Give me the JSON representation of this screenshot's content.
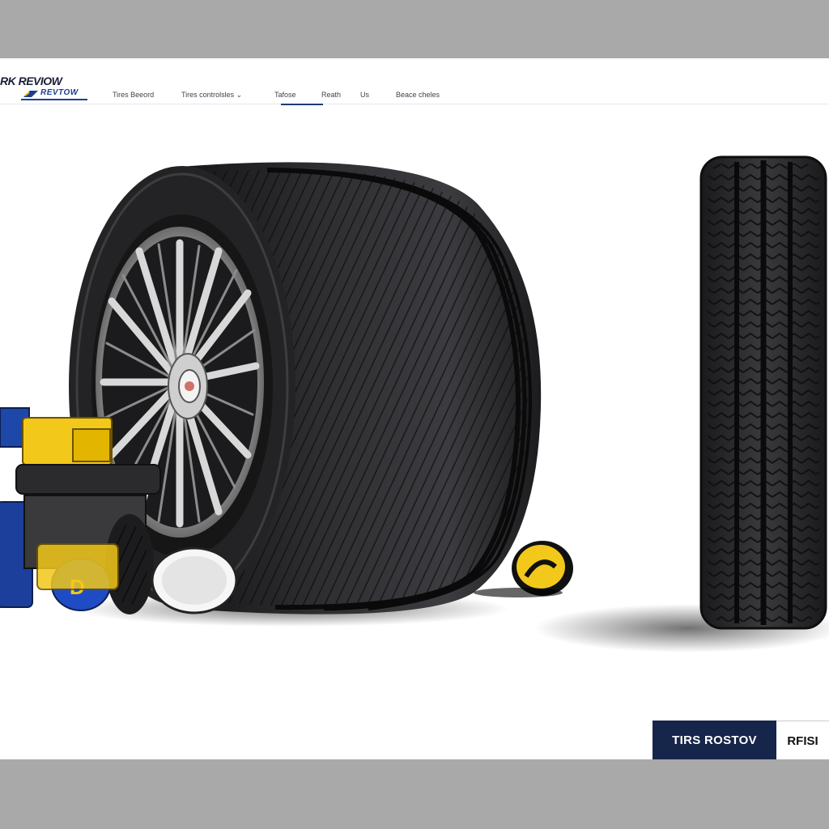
{
  "brand": {
    "logo_text": "RK REVIOW",
    "logo_sub": "REVTOW"
  },
  "nav": {
    "items": [
      {
        "label": "Tires Beeord"
      },
      {
        "label": "Tires controlsles ⌄"
      },
      {
        "label": "Tafose"
      },
      {
        "label": "Reath"
      },
      {
        "label": "Us"
      },
      {
        "label": "Beace cheles"
      }
    ],
    "active_index": 2
  },
  "badge": {
    "primary_label": "TIRS ROSTOV",
    "secondary_label": "RFISI"
  },
  "colors": {
    "navy": "#16254a",
    "accent_blue": "#1d3f8f",
    "yellow": "#f2c81a",
    "tire_dark": "#1c1c1e"
  },
  "icons": {
    "hero_tire": "tire-with-rim",
    "side_tire": "tire-tread",
    "tools": "tire-service-tools",
    "yellow_disc": "yellow-logo-disc"
  }
}
